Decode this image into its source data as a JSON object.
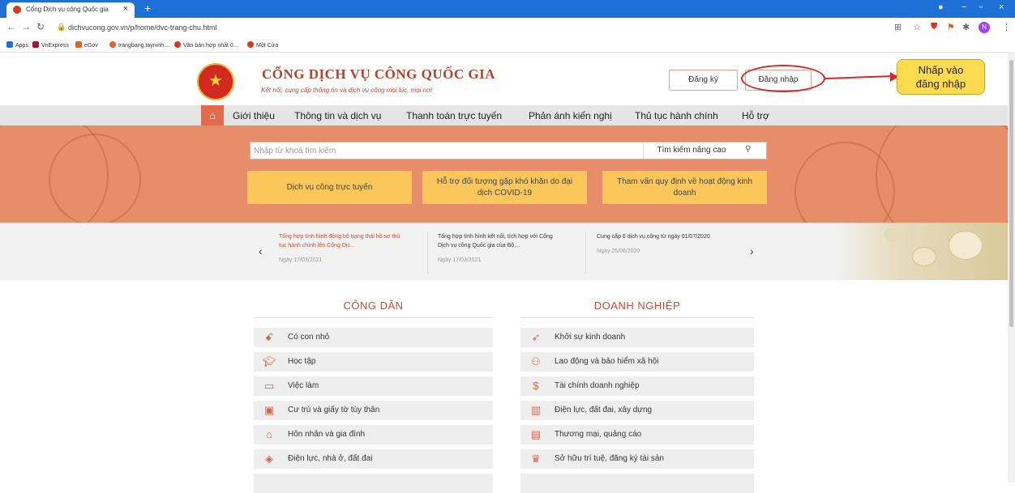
{
  "browser": {
    "tab_title": "Cổng Dịch vụ công Quốc gia",
    "url": "dichvucong.gov.vn/p/home/dvc-trang-chu.html",
    "profile_initial": "N",
    "bookmarks": [
      "Apps",
      "VnExpress",
      "eGov",
      "trangbang.tayninh....",
      "Văn bản hợp nhất 0...",
      "Một Cửa"
    ]
  },
  "header": {
    "title": "CỔNG DỊCH VỤ CÔNG QUỐC GIA",
    "subtitle": "Kết nối, cung cấp thông tin và dịch vụ công mọi lúc, mọi nơi",
    "register_label": "Đăng ký",
    "login_label": "Đăng nhập"
  },
  "annotation": {
    "callout_line1": "Nhấp vào",
    "callout_line2": "đăng nhập",
    "color": "#d42a2a"
  },
  "menu": {
    "items": [
      "Giới thiệu",
      "Thông tin và dịch vụ",
      "Thanh toán trực tuyến",
      "Phản ánh kiến nghị",
      "Thủ tục hành chính",
      "Hỗ trợ"
    ]
  },
  "search": {
    "placeholder": "Nhập từ khoá tìm kiếm",
    "advanced_label": "Tìm kiếm nâng cao"
  },
  "quick_buttons": [
    "Dịch vụ công trực tuyến",
    "Hỗ trợ đối tượng gặp khó khăn do đại dịch COVID-19",
    "Tham vấn quy định về hoạt động kinh doanh"
  ],
  "news": [
    {
      "title": "Tổng hợp tình hình đồng bộ trạng thái hồ sơ thủ tục hành chính lên Cổng Dịc...",
      "date": "Ngày 17/03/2021"
    },
    {
      "title": "Tổng hợp tình hình kết nối, tích hợp với Cổng Dịch vụ công Quốc gia của Bộ,...",
      "date": "Ngày 17/03/2021"
    },
    {
      "title": "Cung cấp 6 dịch vụ công từ ngày 01/07/2020",
      "date": "Ngày 25/06/2020"
    }
  ],
  "citizen": {
    "title": "CÔNG DÂN",
    "items": [
      "Có con nhỏ",
      "Học tập",
      "Việc làm",
      "Cư trú và giấy tờ tùy thân",
      "Hôn nhân và gia đình",
      "Điện lực, nhà ở, đất đai"
    ]
  },
  "business": {
    "title": "DOANH NGHIỆP",
    "items": [
      "Khởi sự kinh doanh",
      "Lao động và bảo hiểm xã hội",
      "Tài chính doanh nghiệp",
      "Điện lực, đất đai, xây dựng",
      "Thương mại, quảng cáo",
      "Sở hữu trí tuệ, đăng ký tài sản"
    ]
  },
  "colors": {
    "accent": "#d24a2a",
    "banner": "#e88d69",
    "button_yellow": "#fbc65a",
    "menubar": "#e5e5e5"
  }
}
